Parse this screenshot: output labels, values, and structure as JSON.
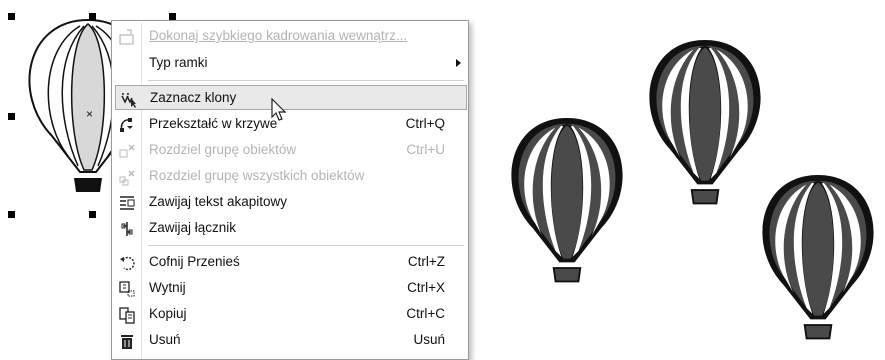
{
  "menu": {
    "items": [
      {
        "label": "Dokonaj szybkiego kadrowania wewnątrz...",
        "shortcut": "",
        "disabled": true,
        "icon": "powerclip-icon"
      },
      {
        "label": "Typ ramki",
        "shortcut": "",
        "disabled": false,
        "submenu": true,
        "icon": ""
      },
      {
        "label": "Zaznacz klony",
        "shortcut": "",
        "disabled": false,
        "highlighted": true,
        "icon": "select-clones-icon"
      },
      {
        "label": "Przekształć w krzywe",
        "shortcut": "Ctrl+Q",
        "disabled": false,
        "icon": "convert-to-curves-icon"
      },
      {
        "label": "Rozdziel grupę obiektów",
        "shortcut": "Ctrl+U",
        "disabled": true,
        "icon": "ungroup-icon"
      },
      {
        "label": "Rozdziel grupę wszystkich obiektów",
        "shortcut": "",
        "disabled": true,
        "icon": "ungroup-all-icon"
      },
      {
        "label": "Zawijaj tekst akapitowy",
        "shortcut": "",
        "disabled": false,
        "icon": "wrap-paragraph-text-icon"
      },
      {
        "label": "Zawijaj łącznik",
        "shortcut": "",
        "disabled": false,
        "icon": "wrap-connector-icon"
      },
      {
        "label": "Cofnij Przenieś",
        "shortcut": "Ctrl+Z",
        "disabled": false,
        "icon": "undo-icon"
      },
      {
        "label": "Wytnij",
        "shortcut": "Ctrl+X",
        "disabled": false,
        "icon": "cut-icon"
      },
      {
        "label": "Kopiuj",
        "shortcut": "Ctrl+C",
        "disabled": false,
        "icon": "copy-icon"
      },
      {
        "label": "Usuń",
        "shortcut": "Usuń",
        "disabled": false,
        "icon": "delete-icon"
      }
    ]
  },
  "canvas": {
    "selected_object_marker": "×",
    "colors": {
      "balloon_dark": "#4a4a4a",
      "balloon_selected": "#d8d8d8",
      "stroke": "#111111"
    }
  }
}
